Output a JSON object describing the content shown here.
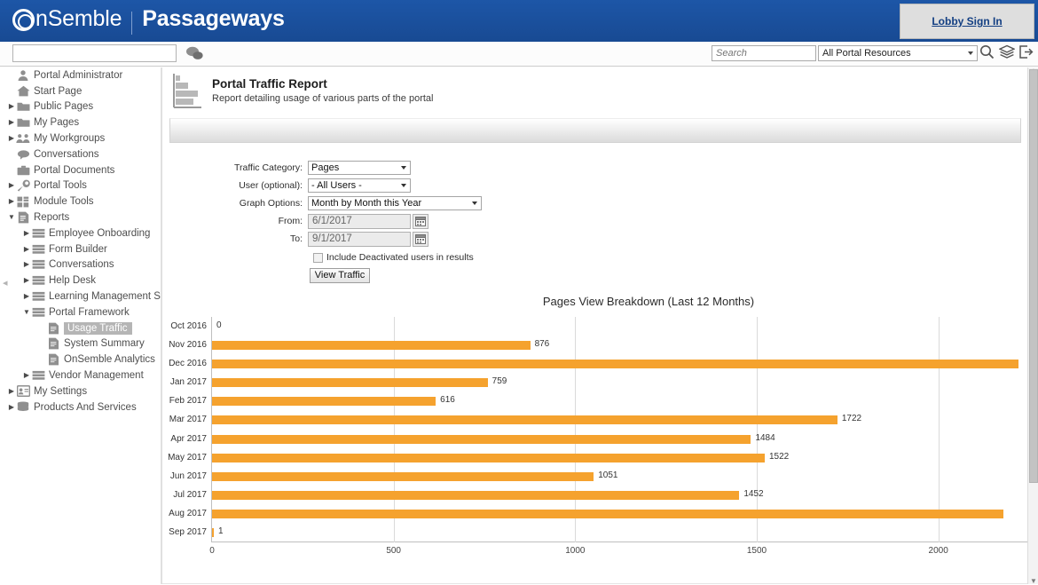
{
  "topbar": {
    "brand_name": "nSemble",
    "brand_sub": "Passageways",
    "logo_icon": "onsemble-circle-logo",
    "lobby_label": "Lobby Sign In"
  },
  "subbar": {
    "left_search_value": "",
    "chat_icon": "chat-bubbles-icon",
    "search_placeholder": "Search",
    "search_value": "",
    "resource_scope": "All Portal Resources",
    "search_icon": "search-icon",
    "layers_icon": "layers-icon",
    "logout_icon": "logout-icon"
  },
  "sidebar": {
    "collapse_icon": "chevron-left-icon",
    "items": [
      {
        "label": "Portal Administrator",
        "icon": "user-icon",
        "indent": 0,
        "twisty": "",
        "selected": false
      },
      {
        "label": "Start Page",
        "icon": "home-icon",
        "indent": 0,
        "twisty": "",
        "selected": false
      },
      {
        "label": "Public Pages",
        "icon": "folder-icon",
        "indent": 0,
        "twisty": "collapsed",
        "selected": false
      },
      {
        "label": "My Pages",
        "icon": "folder-icon",
        "indent": 0,
        "twisty": "collapsed",
        "selected": false
      },
      {
        "label": "My Workgroups",
        "icon": "group-icon",
        "indent": 0,
        "twisty": "collapsed",
        "selected": false
      },
      {
        "label": "Conversations",
        "icon": "conversation-icon",
        "indent": 0,
        "twisty": "",
        "selected": false
      },
      {
        "label": "Portal Documents",
        "icon": "briefcase-icon",
        "indent": 0,
        "twisty": "",
        "selected": false
      },
      {
        "label": "Portal Tools",
        "icon": "wrench-icon",
        "indent": 0,
        "twisty": "collapsed",
        "selected": false
      },
      {
        "label": "Module Tools",
        "icon": "grid-icon",
        "indent": 0,
        "twisty": "collapsed",
        "selected": false
      },
      {
        "label": "Reports",
        "icon": "report-icon",
        "indent": 0,
        "twisty": "expanded",
        "selected": false
      },
      {
        "label": "Employee Onboarding",
        "icon": "stack-icon",
        "indent": 1,
        "twisty": "collapsed",
        "selected": false
      },
      {
        "label": "Form Builder",
        "icon": "stack-icon",
        "indent": 1,
        "twisty": "collapsed",
        "selected": false
      },
      {
        "label": "Conversations",
        "icon": "stack-icon",
        "indent": 1,
        "twisty": "collapsed",
        "selected": false
      },
      {
        "label": "Help Desk",
        "icon": "stack-icon",
        "indent": 1,
        "twisty": "collapsed",
        "selected": false
      },
      {
        "label": "Learning Management System",
        "icon": "stack-icon",
        "indent": 1,
        "twisty": "collapsed",
        "selected": false
      },
      {
        "label": "Portal Framework",
        "icon": "stack-icon",
        "indent": 1,
        "twisty": "expanded",
        "selected": false
      },
      {
        "label": "Usage Traffic",
        "icon": "page-icon",
        "indent": 2,
        "twisty": "",
        "selected": true
      },
      {
        "label": "System Summary",
        "icon": "page-icon",
        "indent": 2,
        "twisty": "",
        "selected": false
      },
      {
        "label": "OnSemble Analytics",
        "icon": "page-icon",
        "indent": 2,
        "twisty": "",
        "selected": false
      },
      {
        "label": "Vendor Management",
        "icon": "stack-icon",
        "indent": 1,
        "twisty": "collapsed",
        "selected": false
      },
      {
        "label": "My Settings",
        "icon": "settings-card-icon",
        "indent": 0,
        "twisty": "collapsed",
        "selected": false
      },
      {
        "label": "Products And Services",
        "icon": "products-icon",
        "indent": 0,
        "twisty": "collapsed",
        "selected": false
      }
    ]
  },
  "report": {
    "icon": "bar-chart-icon",
    "title": "Portal Traffic Report",
    "subtitle": "Report detailing usage of various parts of the portal"
  },
  "form": {
    "traffic_category_label": "Traffic Category:",
    "traffic_category_value": "Pages",
    "user_label": "User (optional):",
    "user_value": "- All Users -",
    "graph_options_label": "Graph Options:",
    "graph_options_value": "Month by Month this Year",
    "from_label": "From:",
    "from_value": "6/1/2017",
    "to_label": "To:",
    "to_value": "9/1/2017",
    "calendar_icon": "calendar-icon",
    "include_deactivated_label": "Include Deactivated users in results",
    "include_deactivated_checked": false,
    "view_traffic_label": "View Traffic"
  },
  "chart_data": {
    "type": "bar",
    "orientation": "horizontal",
    "title": "Pages View Breakdown (Last 12 Months)",
    "categories": [
      "Oct 2016",
      "Nov 2016",
      "Dec 2016",
      "Jan 2017",
      "Feb 2017",
      "Mar 2017",
      "Apr 2017",
      "May 2017",
      "Jun 2017",
      "Jul 2017",
      "Aug 2017",
      "Sep 2017"
    ],
    "values": [
      0,
      876,
      2220,
      759,
      616,
      1722,
      1484,
      1522,
      1051,
      1452,
      2180,
      1
    ],
    "labels": [
      "0",
      "876",
      "",
      "759",
      "616",
      "1722",
      "1484",
      "1522",
      "1051",
      "1452",
      "",
      "1"
    ],
    "xlabel": "",
    "ylabel": "",
    "xlim": [
      0,
      2250
    ],
    "xticks": [
      0,
      500,
      1000,
      1500,
      2000
    ],
    "xtick_labels": [
      "0",
      "500",
      "1000",
      "1500",
      "2000"
    ],
    "bar_color": "#f5a22e",
    "grid": true,
    "legend": false
  },
  "scrollbar": {
    "up_icon": "scroll-up-arrow",
    "down_icon": "scroll-down-arrow"
  }
}
